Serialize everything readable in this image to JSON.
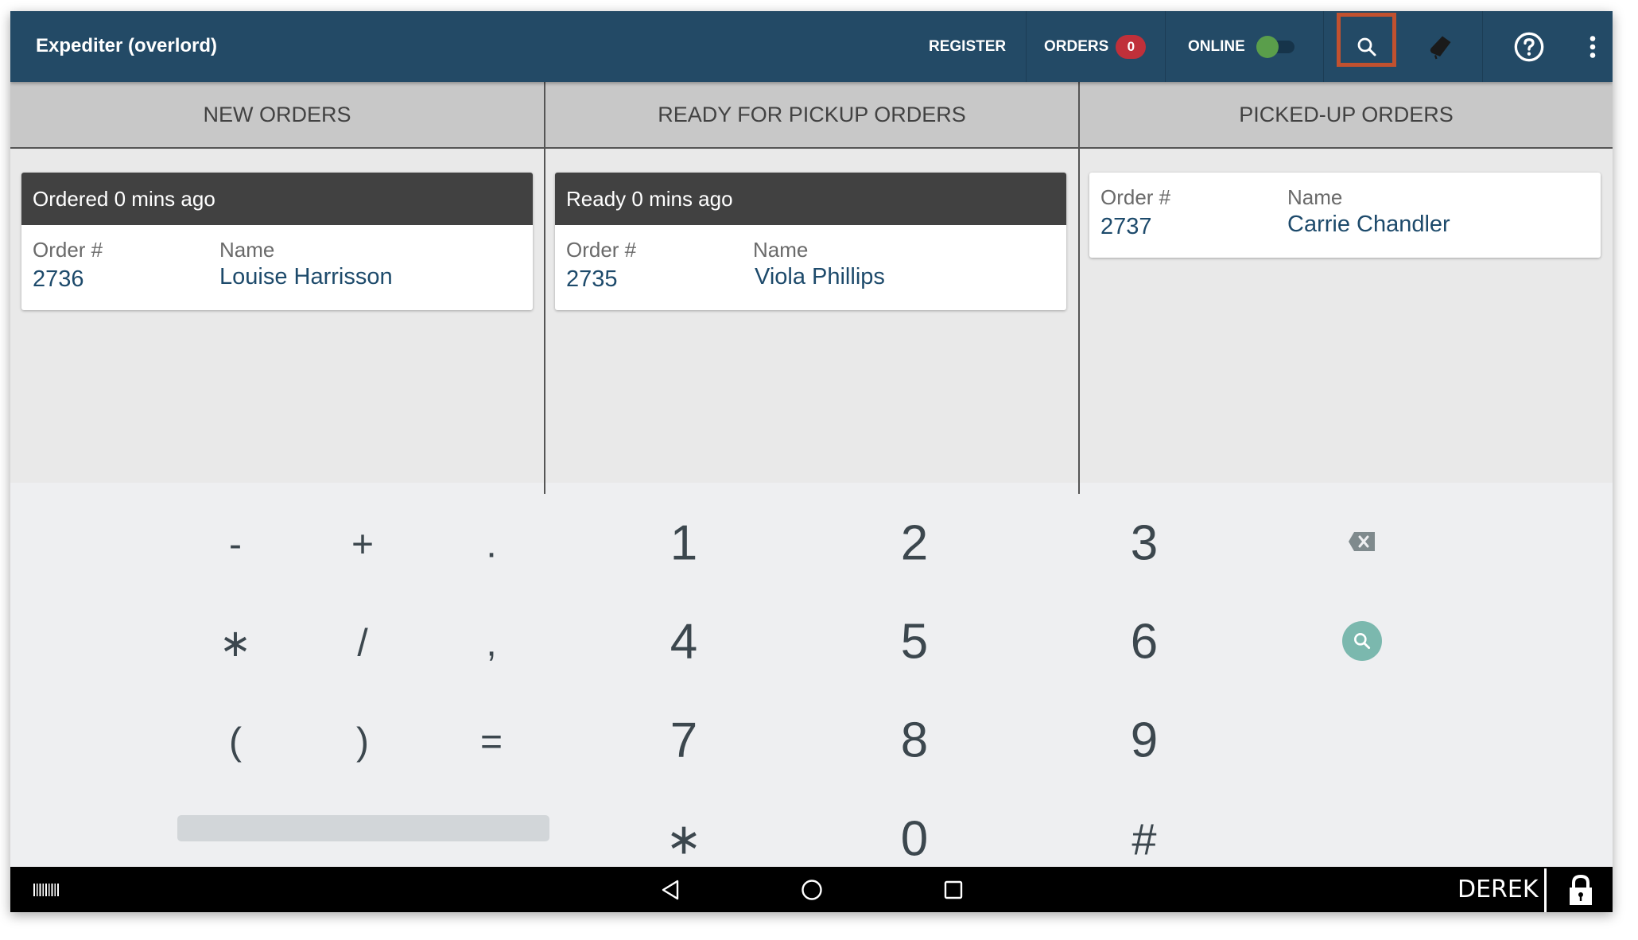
{
  "appbar": {
    "title": "Expediter (overlord)",
    "register_label": "REGISTER",
    "orders_label": "ORDERS",
    "orders_count": "0",
    "online_label": "ONLINE",
    "online_on": true,
    "icons": [
      "search-icon",
      "eraser-icon",
      "help-icon",
      "more-vert-icon"
    ]
  },
  "columns": [
    {
      "title": "NEW ORDERS",
      "cards": [
        {
          "status": "Ordered 0 mins ago",
          "order_label": "Order #",
          "order_number": "2736",
          "name_label": "Name",
          "name": "Louise Harrisson"
        }
      ]
    },
    {
      "title": "READY FOR PICKUP ORDERS",
      "cards": [
        {
          "status": "Ready 0 mins ago",
          "order_label": "Order #",
          "order_number": "2735",
          "name_label": "Name",
          "name": "Viola Phillips"
        }
      ]
    },
    {
      "title": "PICKED-UP ORDERS",
      "cards": [
        {
          "order_label": "Order #",
          "order_number": "2737",
          "name_label": "Name",
          "name": "Carrie Chandler"
        }
      ]
    }
  ],
  "keyboard": {
    "symbols": [
      "-",
      "+",
      ".",
      "∗",
      "/",
      ",",
      "(",
      ")",
      "="
    ],
    "digits": [
      "1",
      "2",
      "3",
      "4",
      "5",
      "6",
      "7",
      "8",
      "9",
      "∗",
      "0",
      "#"
    ],
    "actions": [
      "backspace-icon",
      "search-icon"
    ]
  },
  "navbar": {
    "user": "DEREK",
    "icons": [
      "barcode-icon",
      "back-icon",
      "home-icon",
      "recents-icon",
      "lock-icon"
    ]
  },
  "colors": {
    "appbar": "#234a66",
    "badge": "#c0303a",
    "toggle_on": "#5a9e4b",
    "highlight": "#c1512f",
    "order_value": "#1d4a6b",
    "search_action": "#7bb8ae"
  }
}
